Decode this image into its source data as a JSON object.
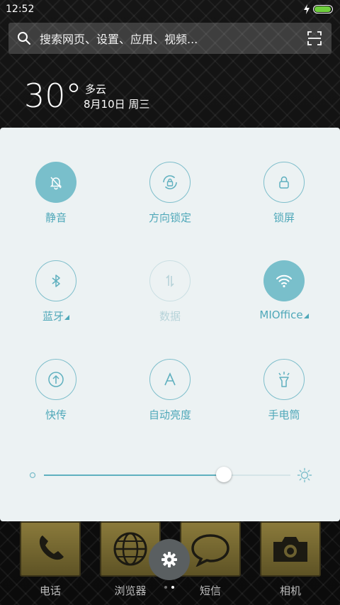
{
  "status_bar": {
    "time": "12:52"
  },
  "search": {
    "placeholder": "搜索网页、设置、应用、视频..."
  },
  "weather": {
    "temp": "30°",
    "condition": "多云",
    "date": "8月10日 周三"
  },
  "toggles": [
    {
      "label": "静音",
      "icon": "bell-off-icon",
      "state": "on"
    },
    {
      "label": "方向锁定",
      "icon": "rotation-lock-icon",
      "state": "off"
    },
    {
      "label": "锁屏",
      "icon": "lock-icon",
      "state": "off"
    },
    {
      "label": "蓝牙",
      "icon": "bluetooth-icon",
      "state": "off"
    },
    {
      "label": "数据",
      "icon": "data-arrows-icon",
      "state": "disabled"
    },
    {
      "label": "MIOffice",
      "icon": "wifi-icon",
      "state": "on"
    },
    {
      "label": "快传",
      "icon": "transfer-icon",
      "state": "off"
    },
    {
      "label": "自动亮度",
      "icon": "auto-brightness-icon",
      "state": "off"
    },
    {
      "label": "手电筒",
      "icon": "flashlight-icon",
      "state": "off"
    }
  ],
  "brightness": {
    "level": 0.73
  },
  "dock": [
    {
      "label": "电话",
      "icon": "phone-icon"
    },
    {
      "label": "浏览器",
      "icon": "globe-icon"
    },
    {
      "label": "短信",
      "icon": "message-icon"
    },
    {
      "label": "相机",
      "icon": "camera-icon"
    }
  ],
  "colors": {
    "accent": "#79bfcb",
    "label": "#4fa8b9",
    "panel": "#ecf2f3",
    "battery": "#6fcf3d"
  }
}
